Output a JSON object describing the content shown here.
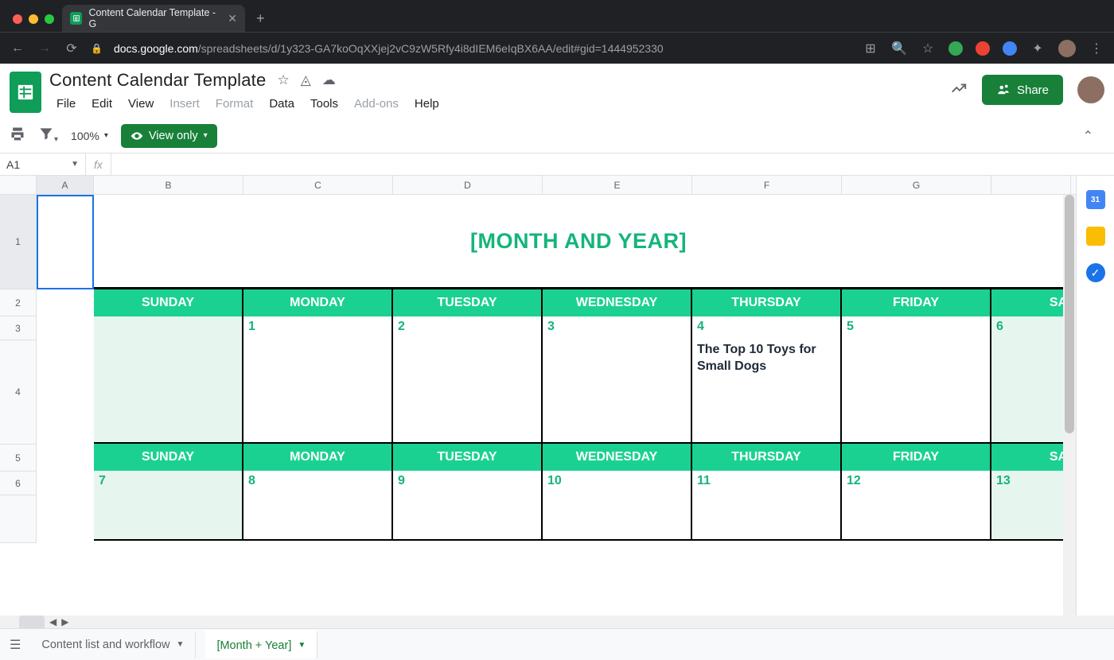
{
  "browser": {
    "tab_title": "Content Calendar Template - G",
    "url_host": "docs.google.com",
    "url_path": "/spreadsheets/d/1y323-GA7koOqXXjej2vC9zW5Rfy4i8dIEM6eIqBX6AA/edit#gid=1444952330"
  },
  "doc": {
    "title": "Content Calendar Template",
    "menus": [
      "File",
      "Edit",
      "View",
      "Insert",
      "Format",
      "Data",
      "Tools",
      "Add-ons",
      "Help"
    ],
    "menu_disabled": [
      "Insert",
      "Format",
      "Add-ons"
    ],
    "share_label": "Share",
    "zoom": "100%",
    "view_only": "View only",
    "name_box": "A1",
    "fx_label": "fx"
  },
  "columns": [
    "A",
    "B",
    "C",
    "D",
    "E",
    "F",
    "G"
  ],
  "rows_visible": [
    "1",
    "2",
    "3",
    "4",
    "5",
    "6"
  ],
  "calendar": {
    "title": "[MONTH AND YEAR]",
    "day_headers": [
      "SUNDAY",
      "MONDAY",
      "TUESDAY",
      "WEDNESDAY",
      "THURSDAY",
      "FRIDAY",
      "SATU"
    ],
    "week1_dates": [
      "",
      "1",
      "2",
      "3",
      "4",
      "5",
      "6"
    ],
    "week1_weekend": [
      true,
      false,
      false,
      false,
      false,
      false,
      true
    ],
    "week1_content": [
      "",
      "",
      "",
      "",
      "The Top 10 Toys for Small Dogs",
      "",
      ""
    ],
    "week2_dates": [
      "7",
      "8",
      "9",
      "10",
      "11",
      "12",
      "13"
    ],
    "week2_weekend": [
      true,
      false,
      false,
      false,
      false,
      false,
      true
    ]
  },
  "sheet_tabs": {
    "inactive": "Content list and workflow",
    "active": "[Month + Year]"
  },
  "colors": {
    "green_header": "#1bd192",
    "green_text": "#14b57a",
    "weekend_bg": "#e6f6ee",
    "share_green": "#188038"
  }
}
